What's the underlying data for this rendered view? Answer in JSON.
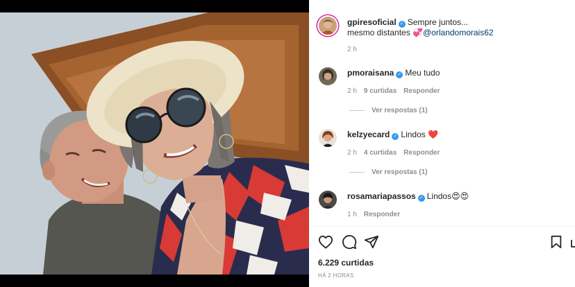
{
  "caption": {
    "username": "gpiresoficial",
    "line1": "Sempre juntos...",
    "line2_prefix": "mesmo distantes ",
    "emoji": "💞",
    "mention": "@orlandomorais62",
    "time": "2 h"
  },
  "comments": [
    {
      "username": "pmoraisana",
      "text": "Meu tudo",
      "time": "2 h",
      "likes": "9 curtidas",
      "reply": "Responder",
      "view_replies": "Ver respostas (1)"
    },
    {
      "username": "kelzyecard",
      "text": "Lindos ❤️",
      "time": "2 h",
      "likes": "4 curtidas",
      "reply": "Responder",
      "view_replies": "Ver respostas (1)"
    },
    {
      "username": "rosamariapassos",
      "text": "Lindos😍😍",
      "time": "1 h",
      "reply": "Responder"
    }
  ],
  "actions": {
    "like_icon": "heart-icon",
    "comment_icon": "comment-icon",
    "share_icon": "send-icon",
    "save_icon": "bookmark-icon"
  },
  "stats": {
    "likes": "6.229 curtidas",
    "posted": "HÁ 2 HORAS"
  },
  "colors": {
    "verified": "#3897f0",
    "link": "#00376b",
    "muted": "#8e8e8e",
    "story_ring": "#d6249f"
  }
}
